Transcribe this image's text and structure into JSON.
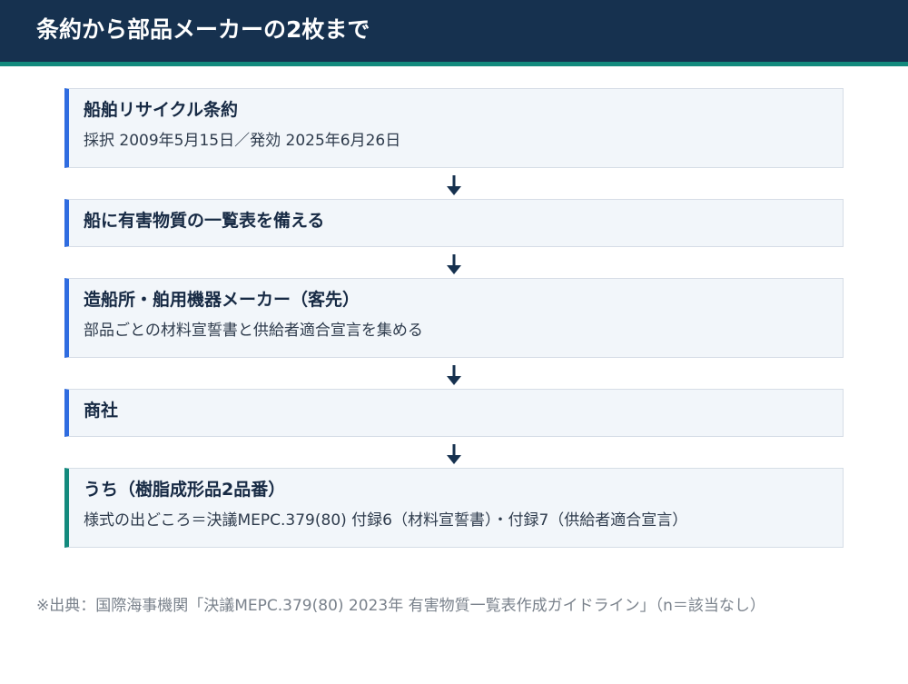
{
  "header": {
    "title": "条約から部品メーカーの2枚まで"
  },
  "flow": [
    {
      "title": "船舶リサイクル条約",
      "subtitle": "採択 2009年5月15日／発効 2025年6月26日",
      "accent": "#2f6ce0"
    },
    {
      "title": "船に有害物質の一覧表を備える",
      "subtitle": "",
      "accent": "#2f6ce0"
    },
    {
      "title": "造船所・舶用機器メーカー（客先）",
      "subtitle": "部品ごとの材料宣誓書と供給者適合宣言を集める",
      "accent": "#2f6ce0"
    },
    {
      "title": "商社",
      "subtitle": "",
      "accent": "#2f6ce0"
    },
    {
      "title": "うち（樹脂成形品2品番）",
      "subtitle": "様式の出どころ＝決議MEPC.379(80) 付録6（材料宣誓書）・付録7（供給者適合宣言）",
      "accent": "#138a7d"
    }
  ],
  "source": "※出典：国際海事機関「決議MEPC.379(80) 2023年 有害物質一覧表作成ガイドライン」（n＝該当なし）",
  "colors": {
    "header_bg": "#16314f",
    "header_rule": "#138a7d",
    "box_bg": "#f2f6fa",
    "arrow": "#16314f"
  }
}
